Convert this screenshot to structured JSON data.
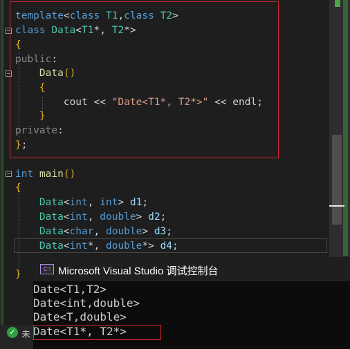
{
  "editor": {
    "lines": [
      {
        "k": "l1",
        "parts": [
          [
            "kw",
            "template"
          ],
          [
            "pl",
            "<"
          ],
          [
            "kw",
            "class"
          ],
          [
            "pl",
            " "
          ],
          [
            "ty",
            "T1"
          ],
          [
            "pl",
            ","
          ],
          [
            "kw",
            "class"
          ],
          [
            "pl",
            " "
          ],
          [
            "ty",
            "T2"
          ],
          [
            "pl",
            ">"
          ]
        ]
      },
      {
        "k": "l2",
        "parts": [
          [
            "kw",
            "class"
          ],
          [
            "pl",
            " "
          ],
          [
            "ty",
            "Data"
          ],
          [
            "pl",
            "<"
          ],
          [
            "ty",
            "T1"
          ],
          [
            "pl",
            "*, "
          ],
          [
            "ty",
            "T2"
          ],
          [
            "pl",
            "*>"
          ]
        ]
      },
      {
        "k": "l3",
        "parts": [
          [
            "br",
            "{"
          ]
        ]
      },
      {
        "k": "l4",
        "parts": [
          [
            "gr",
            "public"
          ],
          [
            "pl",
            ":"
          ]
        ]
      },
      {
        "k": "l5",
        "parts": [
          [
            "pl",
            "    "
          ],
          [
            "fn",
            "Data"
          ],
          [
            "br",
            "()"
          ]
        ]
      },
      {
        "k": "l6",
        "parts": [
          [
            "pl",
            "    "
          ],
          [
            "br",
            "{"
          ]
        ]
      },
      {
        "k": "l7",
        "parts": [
          [
            "pl",
            "        cout << "
          ],
          [
            "st",
            "\"Date<T1*, T2*>\""
          ],
          [
            "pl",
            " << endl;"
          ]
        ]
      },
      {
        "k": "l8",
        "parts": [
          [
            "pl",
            "    "
          ],
          [
            "br",
            "}"
          ]
        ]
      },
      {
        "k": "l9",
        "parts": [
          [
            "gr",
            "private"
          ],
          [
            "pl",
            ":"
          ]
        ]
      },
      {
        "k": "l10",
        "parts": [
          [
            "br",
            "}"
          ],
          [
            "pl",
            ";"
          ]
        ]
      },
      {
        "k": "l11",
        "parts": [
          [
            "kw",
            "int"
          ],
          [
            "pl",
            " "
          ],
          [
            "fn",
            "main"
          ],
          [
            "br",
            "()"
          ]
        ]
      },
      {
        "k": "l12",
        "parts": [
          [
            "br",
            "{"
          ]
        ]
      },
      {
        "k": "l13",
        "parts": [
          [
            "pl",
            "    "
          ],
          [
            "ty",
            "Data"
          ],
          [
            "pl",
            "<"
          ],
          [
            "kw",
            "int"
          ],
          [
            "pl",
            ", "
          ],
          [
            "kw",
            "int"
          ],
          [
            "pl",
            "> "
          ],
          [
            "vr",
            "d1"
          ],
          [
            "pl",
            ";"
          ]
        ]
      },
      {
        "k": "l14",
        "parts": [
          [
            "pl",
            "    "
          ],
          [
            "ty",
            "Data"
          ],
          [
            "pl",
            "<"
          ],
          [
            "kw",
            "int"
          ],
          [
            "pl",
            ", "
          ],
          [
            "kw",
            "double"
          ],
          [
            "pl",
            "> "
          ],
          [
            "vr",
            "d2"
          ],
          [
            "pl",
            ";"
          ]
        ]
      },
      {
        "k": "l15",
        "parts": [
          [
            "pl",
            "    "
          ],
          [
            "ty",
            "Data"
          ],
          [
            "pl",
            "<"
          ],
          [
            "kw",
            "char"
          ],
          [
            "pl",
            ", "
          ],
          [
            "kw",
            "double"
          ],
          [
            "pl",
            "> "
          ],
          [
            "vr",
            "d3"
          ],
          [
            "pl",
            ";"
          ]
        ]
      },
      {
        "k": "l16",
        "parts": [
          [
            "pl",
            "    "
          ],
          [
            "ty",
            "Data"
          ],
          [
            "pl",
            "<"
          ],
          [
            "kw",
            "int"
          ],
          [
            "pl",
            "*, "
          ],
          [
            "kw",
            "double"
          ],
          [
            "pl",
            "*> "
          ],
          [
            "vr",
            "d4"
          ],
          [
            "pl",
            ";"
          ]
        ]
      },
      {
        "k": "l17",
        "parts": [
          [
            "br",
            "}"
          ]
        ]
      }
    ]
  },
  "console": {
    "title": "Microsoft Visual Studio 调试控制台",
    "icon_label": "C:\\",
    "output": [
      "Date<T1,T2>",
      "Date<int,double>",
      "Date<T,double>",
      "Date<T1*, T2*>"
    ]
  },
  "status": {
    "ok_icon": "check-circle-icon",
    "ok_glyph": "✓",
    "text": "未"
  }
}
